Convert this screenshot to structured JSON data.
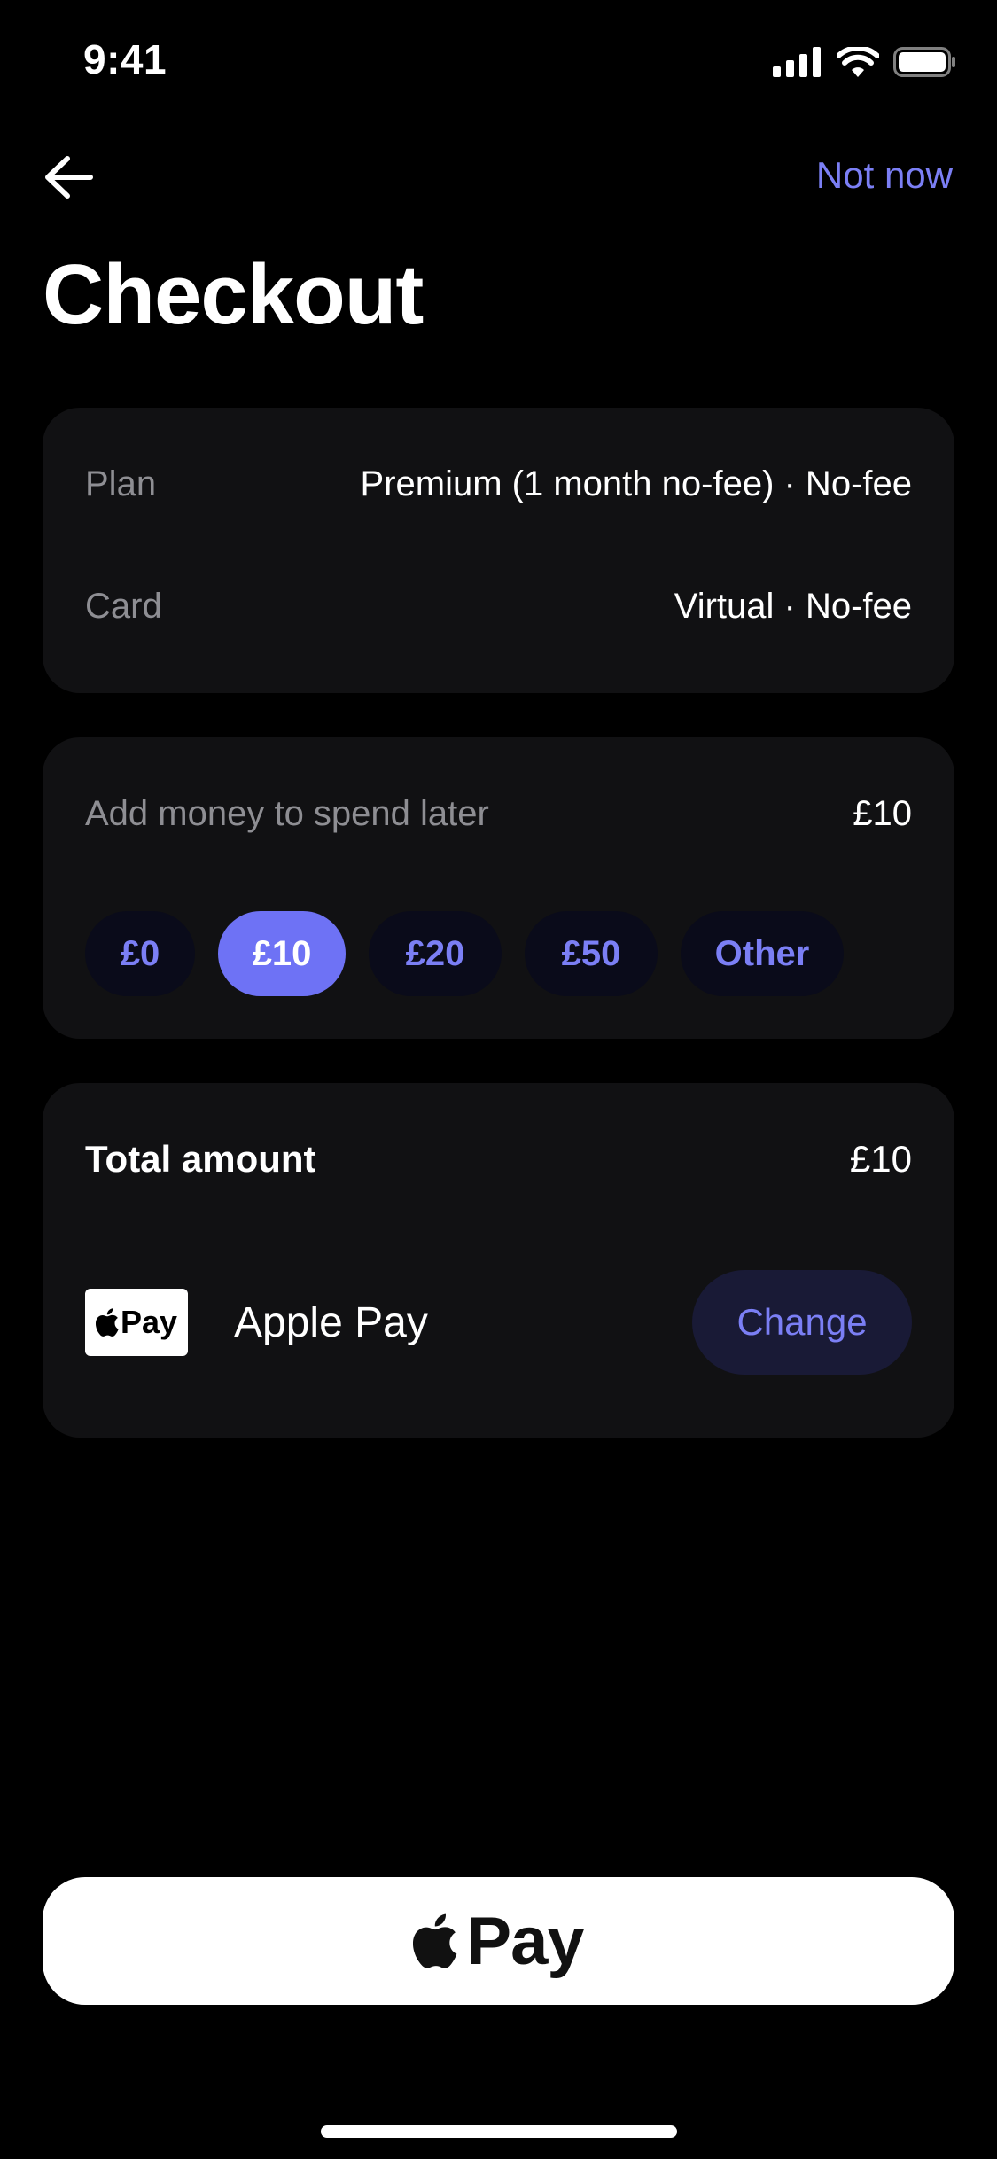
{
  "status_bar": {
    "time": "9:41"
  },
  "header": {
    "not_now": "Not now"
  },
  "page_title": "Checkout",
  "summary": {
    "plan_label": "Plan",
    "plan_value": "Premium (1 month no-fee) · No-fee",
    "card_label": "Card",
    "card_value": "Virtual · No-fee"
  },
  "money": {
    "label": "Add money to spend later",
    "value": "£10",
    "chips": [
      "£0",
      "£10",
      "£20",
      "£50",
      "Other"
    ],
    "selected": "£10"
  },
  "total": {
    "label": "Total amount",
    "value": "£10",
    "payment_logo_text": "Pay",
    "payment_method": "Apple Pay",
    "change_label": "Change"
  },
  "pay_button": {
    "label": "Pay"
  },
  "colors": {
    "accent": "#7b7ff5",
    "selected_chip": "#6e72f5",
    "card_bg": "#111113"
  }
}
